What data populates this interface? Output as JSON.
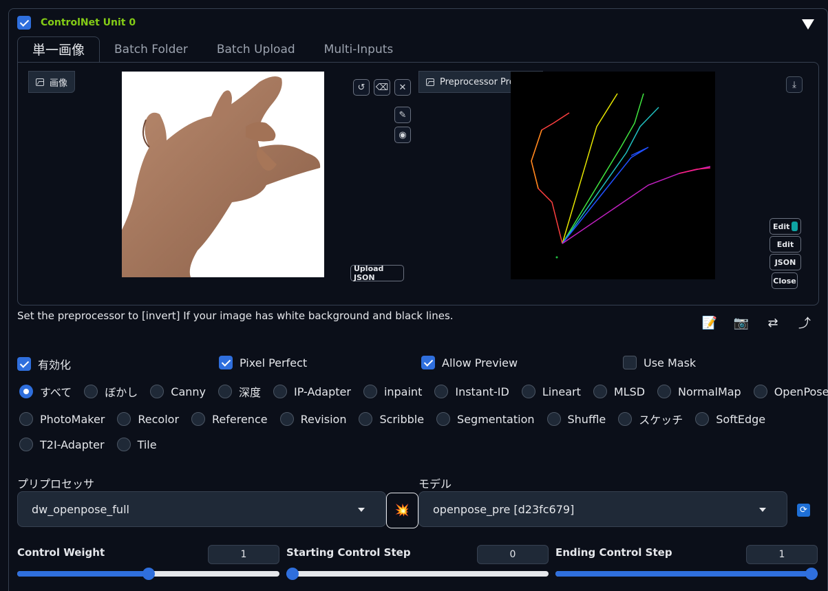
{
  "unit": {
    "title": "ControlNet Unit 0",
    "enabled": true
  },
  "tabs": [
    "単一画像",
    "Batch Folder",
    "Batch Upload",
    "Multi-Inputs"
  ],
  "image_panel": {
    "label": "画像"
  },
  "preview_panel": {
    "label": "Preprocessor Preview"
  },
  "buttons": {
    "upload_json": "Upload JSON",
    "edit_photopea": "Edit",
    "edit": "Edit",
    "json": "JSON",
    "close": "Close"
  },
  "hint": "Set the preprocessor to [invert] If your image has white background and black lines.",
  "checkboxes": [
    {
      "label": "有効化",
      "checked": true
    },
    {
      "label": "Pixel Perfect",
      "checked": true
    },
    {
      "label": "Allow Preview",
      "checked": true
    },
    {
      "label": "Use Mask",
      "checked": false
    }
  ],
  "control_types": {
    "selected": "すべて",
    "rows": [
      [
        "すべて",
        "ぼかし",
        "Canny",
        "深度",
        "IP-Adapter",
        "inpaint",
        "Instant-ID",
        "Lineart",
        "MLSD",
        "NormalMap",
        "OpenPose"
      ],
      [
        "PhotoMaker",
        "Recolor",
        "Reference",
        "Revision",
        "Scribble",
        "Segmentation",
        "Shuffle",
        "スケッチ",
        "SoftEdge"
      ],
      [
        "T2I-Adapter",
        "Tile"
      ]
    ]
  },
  "preprocessor": {
    "label": "プリプロセッサ",
    "value": "dw_openpose_full"
  },
  "model": {
    "label": "モデル",
    "value": "openpose_pre [d23fc679]"
  },
  "sliders": {
    "control_weight": {
      "label": "Control Weight",
      "value": "1",
      "fraction": 0.5
    },
    "starting_step": {
      "label": "Starting Control Step",
      "value": "0",
      "fraction": 0.0
    },
    "ending_step": {
      "label": "Ending Control Step",
      "value": "1",
      "fraction": 1.0
    }
  },
  "colors": {
    "accent": "#2f6fdd",
    "unit_title": "#84cc16",
    "background": "#0b0f19"
  }
}
